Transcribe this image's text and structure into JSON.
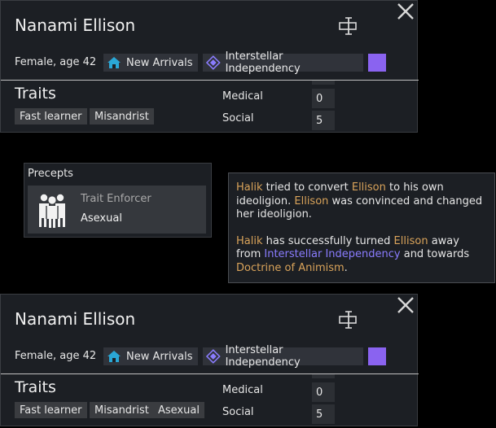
{
  "cards": [
    {
      "name": "Nanami Ellison",
      "meta": "Female, age 42",
      "faction": "New Arrivals",
      "ideoligion": "Interstellar Independency",
      "traits_title": "Traits",
      "traits": [
        "Fast learner",
        "Misandrist"
      ],
      "skills": [
        {
          "label": "Medical",
          "value": "0"
        },
        {
          "label": "Social",
          "value": "5"
        }
      ]
    },
    {
      "name": "Nanami Ellison",
      "meta": "Female, age 42",
      "faction": "New Arrivals",
      "ideoligion": "Interstellar Independency",
      "traits_title": "Traits",
      "traits": [
        "Fast learner",
        "Misandrist",
        "Asexual"
      ],
      "skills": [
        {
          "label": "Medical",
          "value": "0"
        },
        {
          "label": "Social",
          "value": "5"
        }
      ]
    }
  ],
  "precepts": {
    "title": "Precepts",
    "items": [
      {
        "kind": "Trait Enforcer",
        "value": "Asexual"
      }
    ]
  },
  "tooltip": {
    "p1": {
      "a": "Halik",
      "b": " tried to convert ",
      "c": "Ellison",
      "d": " to his own ideoligion. ",
      "e": "Ellison",
      "f": " was convinced and changed her ideoligion."
    },
    "p2": {
      "a": "Halik",
      "b": " has successfully turned ",
      "c": "Ellison",
      "d": " away from ",
      "e": "Interstellar Independency",
      "f": " and towards ",
      "g": "Doctrine of Animism",
      "h": "."
    }
  },
  "icons": [
    "close-icon",
    "rename-icon",
    "faction-house-icon",
    "ideoligion-diamond-icon",
    "precept-people-icon"
  ],
  "colors": {
    "ideo_swatch": "#8a63f0",
    "name_highlight": "#d9a35a",
    "ideo_highlight": "#8a7cff"
  }
}
